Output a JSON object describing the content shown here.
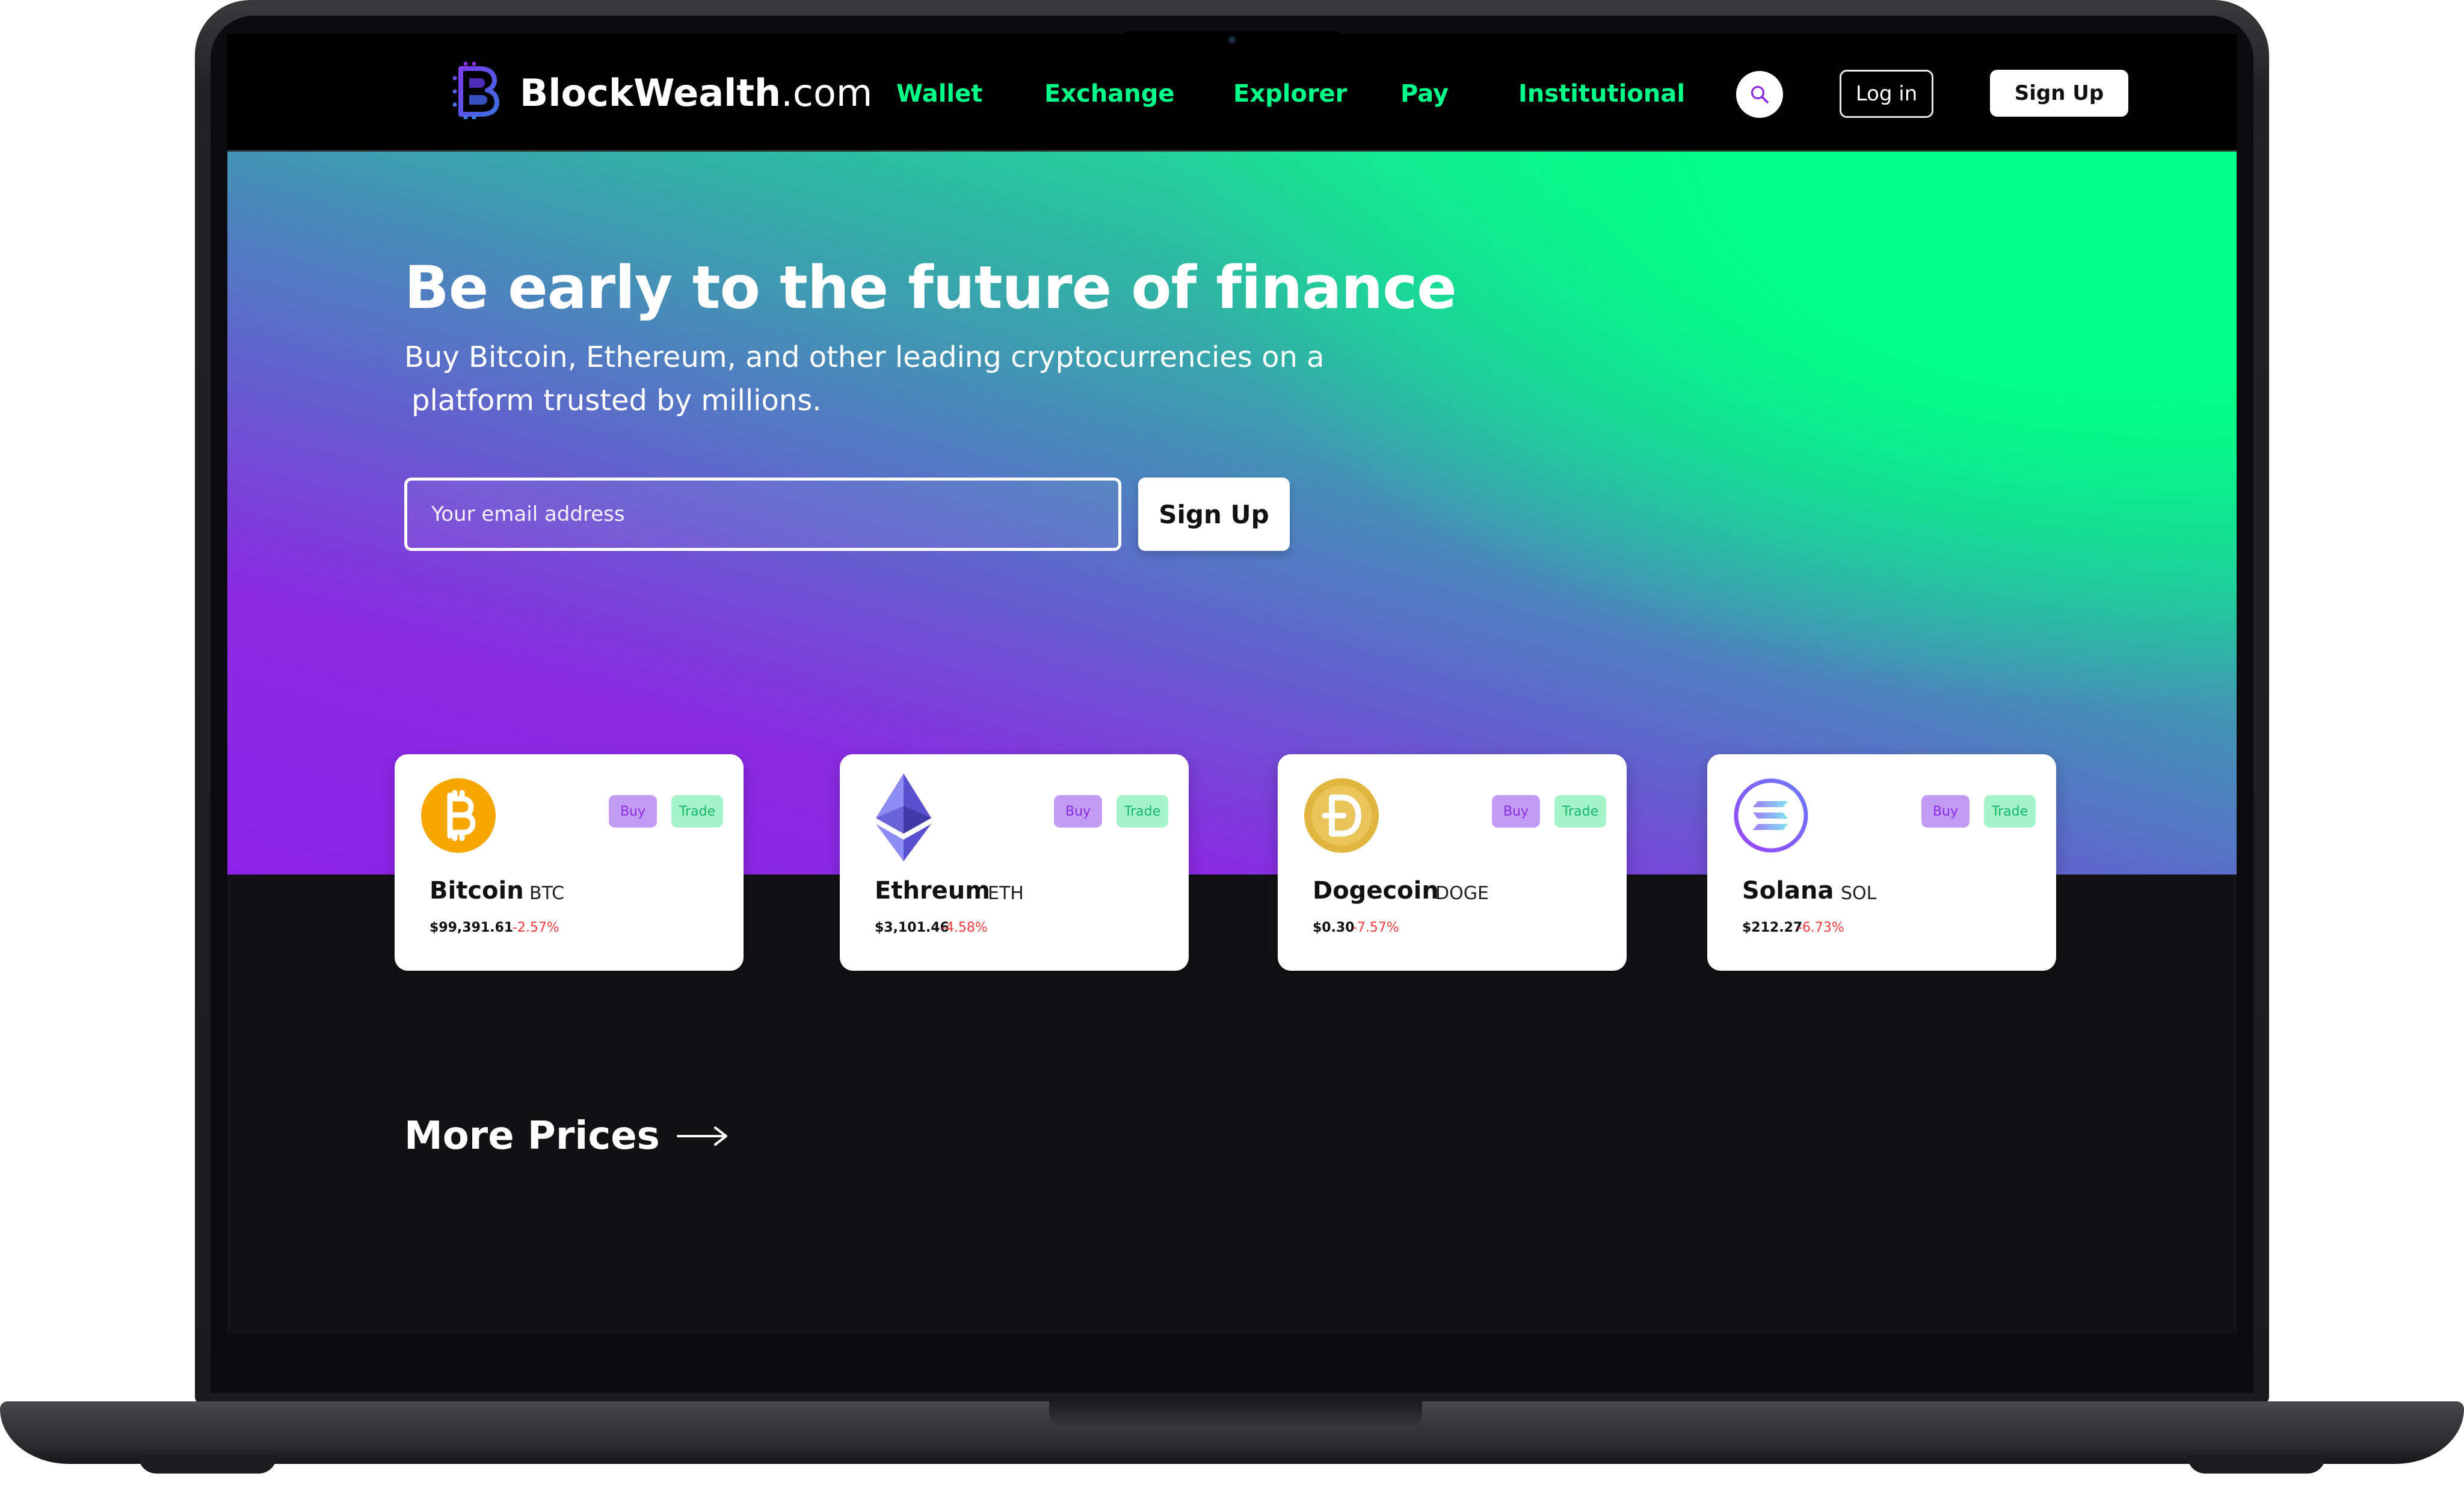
{
  "brand": {
    "name": "BlockWealth",
    "domain_suffix": ".com",
    "accent": "#00ff88",
    "purple": "#8a2be2"
  },
  "nav": {
    "links": [
      "Wallet",
      "Exchange",
      "Explorer",
      "Pay",
      "Institutional"
    ],
    "search_icon": "search-icon",
    "login_label": "Log in",
    "signup_label": "Sign Up"
  },
  "hero": {
    "title": "Be early to the future of finance",
    "subtitle_line1": "Buy Bitcoin, Ethereum, and other leading cryptocurrencies on a",
    "subtitle_line2": "platform trusted by millions.",
    "email_placeholder": "Your email address",
    "signup_label": "Sign Up"
  },
  "coins": [
    {
      "name": "Bitcoin",
      "symbol": "BTC",
      "price": "$99,391.61",
      "change": "-2.57%",
      "buy_label": "Buy",
      "trade_label": "Trade",
      "icon": "bitcoin-icon",
      "color": "#f7a600"
    },
    {
      "name": "Ethreum",
      "symbol": "ETH",
      "price": "$3,101.46",
      "change": "-4.58%",
      "buy_label": "Buy",
      "trade_label": "Trade",
      "icon": "ethereum-icon",
      "color": "#627eea"
    },
    {
      "name": "Dogecoin",
      "symbol": "DOGE",
      "price": "$0.30",
      "change": "-7.57%",
      "buy_label": "Buy",
      "trade_label": "Trade",
      "icon": "dogecoin-icon",
      "color": "#e1b640"
    },
    {
      "name": "Solana",
      "symbol": "SOL",
      "price": "$212.27",
      "change": "-6.73%",
      "buy_label": "Buy",
      "trade_label": "Trade",
      "icon": "solana-icon",
      "color": "#9945ff"
    }
  ],
  "more_prices": {
    "label": "More Prices",
    "icon": "arrow-right-icon"
  }
}
